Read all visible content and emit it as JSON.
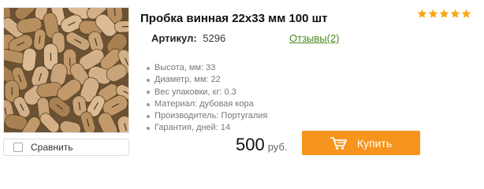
{
  "product": {
    "title": "Пробка винная 22х33 мм 100 шт",
    "rating": 5,
    "sku_label": "Артикул:",
    "sku_value": "5296",
    "reviews_link": "Отзывы(2)",
    "image_icon": "wine-corks-photo"
  },
  "specs": [
    "Высота, мм: 33",
    "Диаметр, мм: 22",
    "Вес упаковки, кг: 0.3",
    "Материал: дубовая кора",
    "Производитель: Португалия",
    "Гарантия, дней: 14"
  ],
  "compare": {
    "label": "Сравнить",
    "checked": false
  },
  "price": {
    "amount": "500",
    "currency": "руб."
  },
  "buy_button": {
    "label": "Купить",
    "icon": "cart-icon"
  },
  "colors": {
    "accent": "#f7941d",
    "star": "#f9a81a",
    "link": "#4a8a1a"
  }
}
